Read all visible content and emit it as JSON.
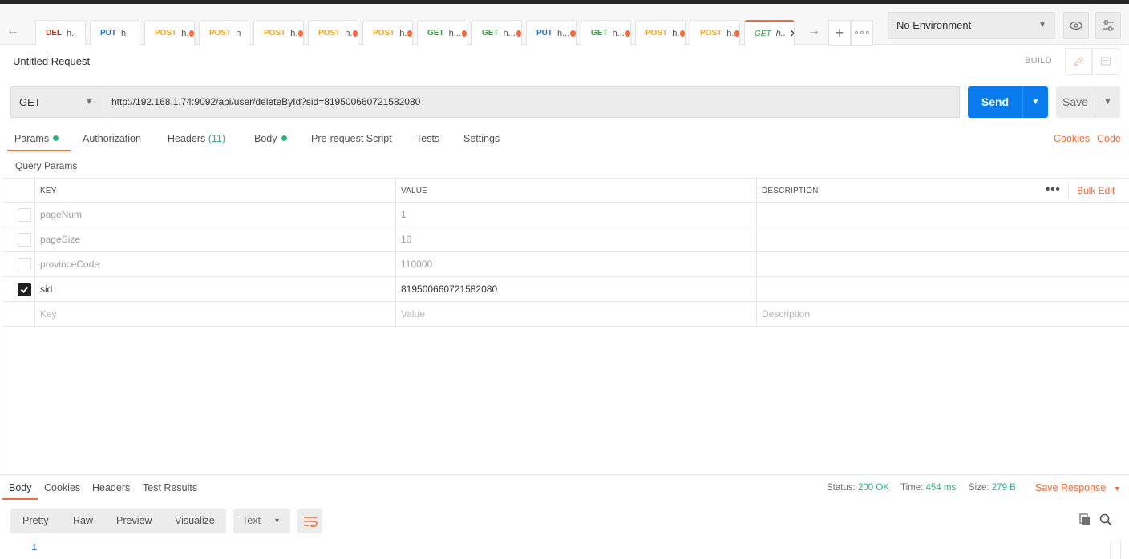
{
  "tabs": [
    {
      "method": "DEL",
      "name": "h..",
      "dirty": false
    },
    {
      "method": "PUT",
      "name": "h.",
      "dirty": false
    },
    {
      "method": "POST",
      "name": "h.",
      "dirty": true
    },
    {
      "method": "POST",
      "name": "h",
      "dirty": false
    },
    {
      "method": "POST",
      "name": "h.",
      "dirty": true
    },
    {
      "method": "POST",
      "name": "h.",
      "dirty": true
    },
    {
      "method": "POST",
      "name": "h.",
      "dirty": true
    },
    {
      "method": "GET",
      "name": "h...",
      "dirty": true
    },
    {
      "method": "GET",
      "name": "h...",
      "dirty": true
    },
    {
      "method": "PUT",
      "name": "h...",
      "dirty": true
    },
    {
      "method": "GET",
      "name": "h...",
      "dirty": true
    },
    {
      "method": "POST",
      "name": "h.",
      "dirty": true
    },
    {
      "method": "POST",
      "name": "h.",
      "dirty": true
    },
    {
      "method": "GET",
      "name": "h..",
      "dirty": false,
      "active": true
    }
  ],
  "environment": {
    "label": "No Environment"
  },
  "request": {
    "title": "Untitled Request",
    "build_label": "BUILD",
    "method": "GET",
    "url": "http://192.168.1.74:9092/api/user/deleteById?sid=819500660721582080",
    "send_label": "Send",
    "save_label": "Save"
  },
  "request_tabs": {
    "params": "Params",
    "authorization": "Authorization",
    "headers": "Headers",
    "headers_count": "(11)",
    "body": "Body",
    "prerequest": "Pre-request Script",
    "tests": "Tests",
    "settings": "Settings",
    "cookies": "Cookies",
    "code": "Code"
  },
  "query_params": {
    "title": "Query Params",
    "columns": {
      "key": "KEY",
      "value": "VALUE",
      "description": "DESCRIPTION"
    },
    "bulk_edit": "Bulk Edit",
    "rows": [
      {
        "key": "pageNum",
        "value": "1",
        "description": "",
        "enabled": false
      },
      {
        "key": "pageSize",
        "value": "10",
        "description": "",
        "enabled": false
      },
      {
        "key": "provinceCode",
        "value": "110000",
        "description": "",
        "enabled": false
      },
      {
        "key": "sid",
        "value": "819500660721582080",
        "description": "",
        "enabled": true
      }
    ],
    "placeholder": {
      "key": "Key",
      "value": "Value",
      "description": "Description"
    }
  },
  "response": {
    "tabs": {
      "body": "Body",
      "cookies": "Cookies",
      "headers": "Headers",
      "test_results": "Test Results"
    },
    "status_label": "Status:",
    "status_value": "200 OK",
    "time_label": "Time:",
    "time_value": "454 ms",
    "size_label": "Size:",
    "size_value": "279 B",
    "save_response": "Save Response",
    "views": {
      "pretty": "Pretty",
      "raw": "Raw",
      "preview": "Preview",
      "visualize": "Visualize"
    },
    "format": "Text",
    "line_number": "1"
  },
  "colors": {
    "accent": "#f26b3a",
    "send": "#097bed",
    "success": "#26b47f"
  }
}
